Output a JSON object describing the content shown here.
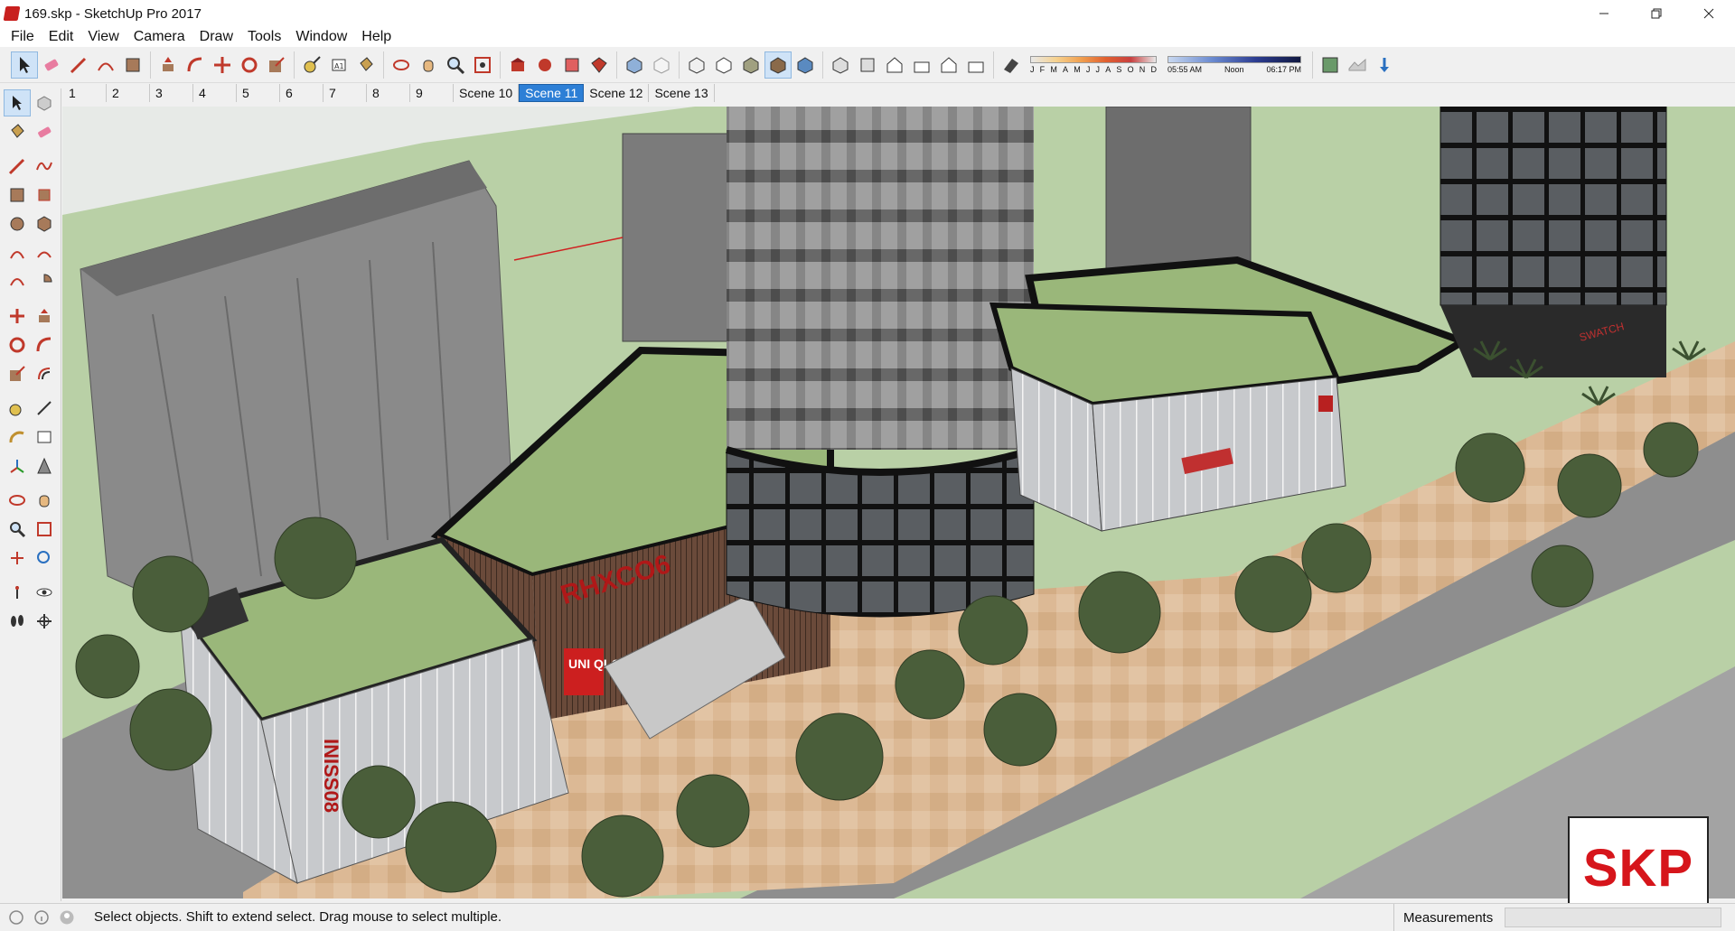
{
  "window": {
    "title": "169.skp - SketchUp Pro 2017",
    "controls": [
      "minimize-icon",
      "restore-icon",
      "close-icon"
    ]
  },
  "menu": [
    "File",
    "Edit",
    "View",
    "Camera",
    "Draw",
    "Tools",
    "Window",
    "Help"
  ],
  "shadow_settings": {
    "months": [
      "J",
      "F",
      "M",
      "A",
      "M",
      "J",
      "J",
      "A",
      "S",
      "O",
      "N",
      "D"
    ],
    "time_start": "05:55 AM",
    "time_mid": "Noon",
    "time_end": "06:17 PM"
  },
  "scenes": {
    "tabs": [
      "1",
      "2",
      "3",
      "4",
      "5",
      "6",
      "7",
      "8",
      "9",
      "Scene 10",
      "Scene 11",
      "Scene 12",
      "Scene 13"
    ],
    "active": "Scene 11"
  },
  "viewport": {
    "signs": {
      "store_1": "RHXCO6",
      "store_2": "UNI QLO",
      "store_3": "INISS08",
      "store_4": "SWATCH"
    }
  },
  "watermark": "SKP",
  "status": {
    "message": "Select objects. Shift to extend select. Drag mouse to select multiple.",
    "measurements_label": "Measurements",
    "measurements_value": ""
  },
  "colors": {
    "accent": "#2d7fd6",
    "roof_green": "#9ab77a",
    "building_gray": "#8a8a8a",
    "tree_green": "#4a5e3a",
    "paving": "#d9b58f",
    "watermark_red": "#d6151b"
  }
}
